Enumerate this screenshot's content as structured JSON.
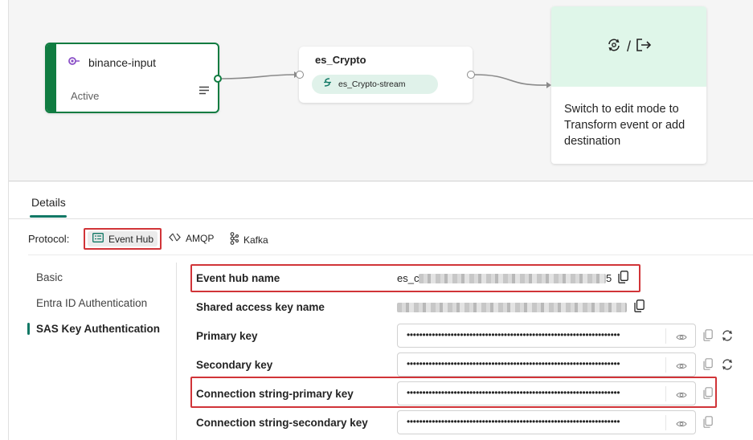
{
  "canvas": {
    "source_node": {
      "title": "binance-input",
      "status": "Active"
    },
    "stream_node": {
      "title": "es_Crypto",
      "pill_label": "es_Crypto-stream"
    },
    "destination_node": {
      "separator": "/",
      "message": "Switch to edit mode to Transform event or add destination"
    },
    "colors": {
      "accent_green": "#107c41",
      "pill_green": "#e0f2ea",
      "dest_green": "#dff6e9"
    }
  },
  "details": {
    "tab_label": "Details",
    "protocol": {
      "label": "Protocol:",
      "options": [
        "Event Hub",
        "AMQP",
        "Kafka"
      ],
      "selected": "Event Hub"
    },
    "sidebar": {
      "items": [
        "Basic",
        "Entra ID Authentication",
        "SAS Key Authentication"
      ],
      "selected": "SAS Key Authentication"
    },
    "fields": {
      "event_hub_name": {
        "label": "Event hub name",
        "value_prefix": "es_c",
        "value_suffix": "5"
      },
      "shared_access_key_name": {
        "label": "Shared access key name"
      },
      "primary_key": {
        "label": "Primary key",
        "masked": "••••••••••••••••••••••••••••••••••••••••••••••••••••••••••••••••••••"
      },
      "secondary_key": {
        "label": "Secondary key",
        "masked": "••••••••••••••••••••••••••••••••••••••••••••••••••••••••••••••••••••"
      },
      "conn_primary": {
        "label": "Connection string-primary key",
        "masked": "••••••••••••••••••••••••••••••••••••••••••••••••••••••••••••••••••••"
      },
      "conn_secondary": {
        "label": "Connection string-secondary key",
        "masked": "••••••••••••••••••••••••••••••••••••••••••••••••••••••••••••••••••••"
      }
    },
    "highlight_color": "#d13438",
    "accent_teal": "#117865"
  }
}
